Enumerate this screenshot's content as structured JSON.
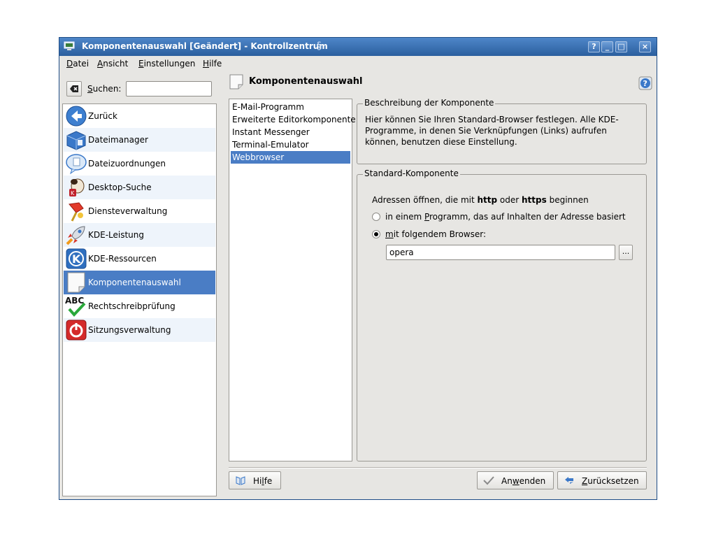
{
  "window": {
    "title": "Komponentenauswahl [Geändert] - Kontrollzentrum",
    "buttons": [
      "?",
      "_",
      "□",
      "×"
    ]
  },
  "menu": {
    "items": [
      {
        "label_pre": "",
        "label_u": "D",
        "label_post": "atei"
      },
      {
        "label_pre": "",
        "label_u": "A",
        "label_post": "nsicht"
      },
      {
        "label_pre": "",
        "label_u": "E",
        "label_post": "instellungen"
      },
      {
        "label_pre": "",
        "label_u": "H",
        "label_post": "ilfe"
      }
    ]
  },
  "search": {
    "label_u": "S",
    "label_post": "uchen:",
    "value": ""
  },
  "sidebar": {
    "items": [
      {
        "label": "Zurück",
        "icon": "back-arrow-icon"
      },
      {
        "label": "Dateimanager",
        "icon": "file-manager-icon"
      },
      {
        "label": "Dateizuordnungen",
        "icon": "file-associations-icon"
      },
      {
        "label": "Desktop-Suche",
        "icon": "desktop-search-icon"
      },
      {
        "label": "Diensteverwaltung",
        "icon": "service-manager-icon"
      },
      {
        "label": "KDE-Leistung",
        "icon": "rocket-icon"
      },
      {
        "label": "KDE-Ressourcen",
        "icon": "kde-logo-icon"
      },
      {
        "label": "Komponentenauswahl",
        "icon": "blank-page-icon"
      },
      {
        "label": "Rechtschreibprüfung",
        "icon": "spellcheck-icon"
      },
      {
        "label": "Sitzungsverwaltung",
        "icon": "power-icon"
      }
    ],
    "selected_index": 7
  },
  "page": {
    "title": "Komponentenauswahl"
  },
  "components": {
    "items": [
      "E-Mail-Programm",
      "Erweiterte Editorkomponente",
      "Instant Messenger",
      "Terminal-Emulator",
      "Webbrowser"
    ],
    "selected_index": 4
  },
  "description": {
    "title": "Beschreibung der Komponente",
    "text": "Hier können Sie Ihren Standard-Browser festlegen. Alle KDE-Programme, in denen Sie Verknüpfungen (Links) aufrufen können, benutzen diese Einstellung."
  },
  "standard": {
    "title": "Standard-Komponente",
    "intro_pre": "Adressen öffnen, die mit ",
    "intro_b1": "http",
    "intro_mid": " oder ",
    "intro_b2": "https",
    "intro_post": " beginnen",
    "option1_pre": "in einem ",
    "option1_u": "P",
    "option1_post": "rogramm, das auf Inhalten der Adresse basiert",
    "option2_u": "m",
    "option2_post": "it folgendem Browser:",
    "selected_option": 2,
    "browser_value": "opera",
    "browse_label": "..."
  },
  "buttons": {
    "help_pre": "Hi",
    "help_u": "l",
    "help_post": "fe",
    "apply_pre": "An",
    "apply_u": "w",
    "apply_post": "enden",
    "reset_u": "Z",
    "reset_post": "urücksetzen"
  },
  "colors": {
    "titlebar": "#2b5f9e",
    "selection": "#4a7dc5",
    "window_bg": "#e7e6e3"
  }
}
